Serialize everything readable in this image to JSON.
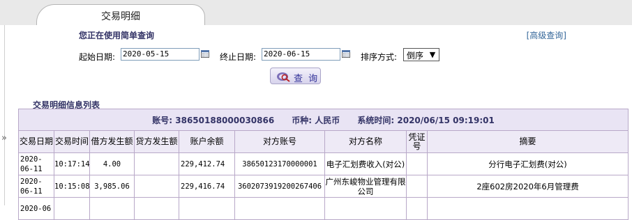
{
  "tab": {
    "title": "交易明细"
  },
  "query": {
    "hint": "您正在使用简单查询",
    "advanced_link": "[高级查询]",
    "start_label": "起始日期:",
    "start_value": "2020-05-15",
    "end_label": "终止日期:",
    "end_value": "2020-06-15",
    "sort_label": "排序方式:",
    "sort_value": "倒序",
    "query_button": "查 询"
  },
  "list": {
    "title": "交易明细信息列表",
    "account_label": "账号:",
    "account_value": "38650188000030866",
    "currency_label": "币种:",
    "currency_value": "人民币",
    "systime_label": "系统时间:",
    "systime_value": "2020/06/15 09:19:01",
    "columns": [
      "交易日期",
      "交易时间",
      "借方发生额",
      "贷方发生额",
      "账户余额",
      "对方账号",
      "对方名称",
      "凭证号",
      "摘要"
    ],
    "rows": [
      {
        "date": "2020-06-11",
        "time": "10:17:14",
        "debit": "4.00",
        "credit": "",
        "balance": "229,412.74",
        "cp_account": "38650123170000001",
        "cp_name": "电子汇划费收入(对公)",
        "voucher": "",
        "summary": "分行电子汇划费(对公)"
      },
      {
        "date": "2020-06-11",
        "time": "10:15:08",
        "debit": "3,985.06",
        "credit": "",
        "balance": "229,416.74",
        "cp_account": "3602073919200267406",
        "cp_name": "广州东峻物业管理有限公司",
        "voucher": "",
        "summary": "2座602房2020年6月管理费"
      },
      {
        "date": "2020-06",
        "time": "",
        "debit": "",
        "credit": "",
        "balance": "",
        "cp_account": "",
        "cp_name": "",
        "voucher": "",
        "summary": ""
      }
    ]
  },
  "icons": {
    "collapse": "double-chevron-right-icon",
    "calendar": "calendar-icon",
    "search": "magnifier-icon"
  }
}
